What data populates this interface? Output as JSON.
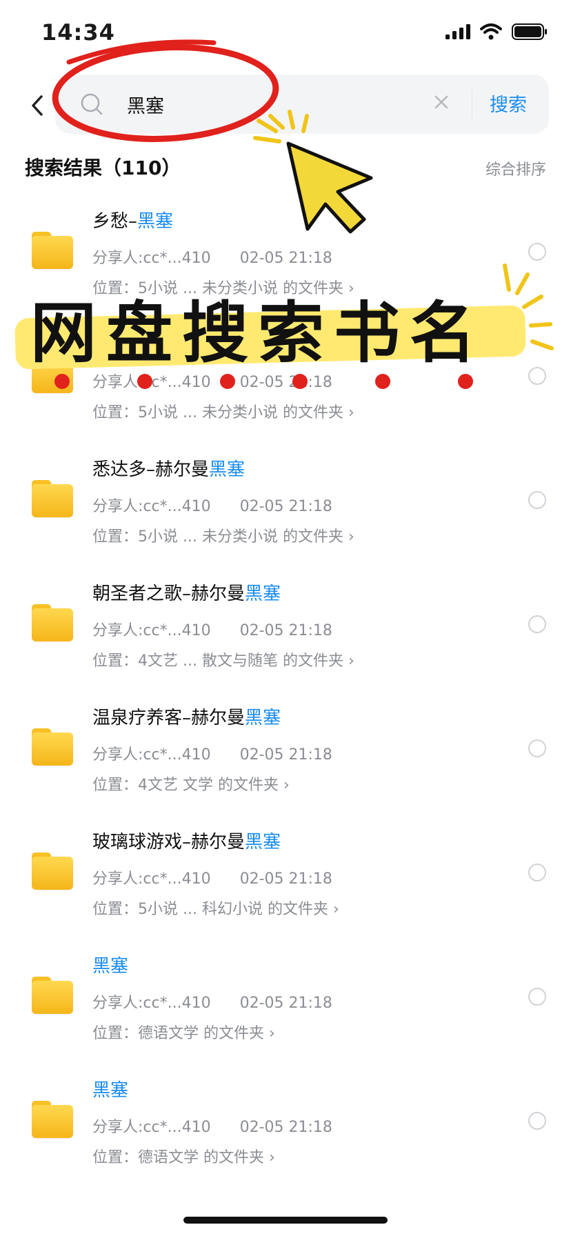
{
  "status_bar": {
    "time": "14:34"
  },
  "search": {
    "query": "黑塞",
    "button_label": "搜索"
  },
  "results": {
    "header": "搜索结果（110）",
    "sort_label": "综合排序"
  },
  "items": [
    {
      "title_prefix": "乡愁–",
      "title_highlight": "黑塞",
      "sharer": "分享人:cc*...410",
      "date": "02-05 21:18",
      "location": "位置：5小说   ... 未分类小说 的文件夹 ›"
    },
    {
      "title_prefix": "",
      "title_highlight": "",
      "sharer": "分享人:cc*...410",
      "date": "02-05 21:18",
      "location": "位置：5小说   ... 未分类小说 的文件夹 ›"
    },
    {
      "title_prefix": "悉达多–赫尔曼",
      "title_highlight": "黑塞",
      "sharer": "分享人:cc*...410",
      "date": "02-05 21:18",
      "location": "位置：5小说   ... 未分类小说 的文件夹 ›"
    },
    {
      "title_prefix": "朝圣者之歌–赫尔曼",
      "title_highlight": "黑塞",
      "sharer": "分享人:cc*...410",
      "date": "02-05 21:18",
      "location": "位置：4文艺   ... 散文与随笔 的文件夹 ›"
    },
    {
      "title_prefix": "温泉疗养客–赫尔曼",
      "title_highlight": "黑塞",
      "sharer": "分享人:cc*...410",
      "date": "02-05 21:18",
      "location": "位置：4文艺      文学 的文件夹 ›"
    },
    {
      "title_prefix": "玻璃球游戏–赫尔曼",
      "title_highlight": "黑塞",
      "sharer": "分享人:cc*...410",
      "date": "02-05 21:18",
      "location": "位置：5小说   ...  科幻小说 的文件夹 ›"
    },
    {
      "title_prefix": "",
      "title_highlight": "黑塞",
      "sharer": "分享人:cc*...410",
      "date": "02-05 21:18",
      "location": "位置：德语文学 的文件夹 ›"
    },
    {
      "title_prefix": "",
      "title_highlight": "黑塞",
      "sharer": "分享人:cc*...410",
      "date": "02-05 21:18",
      "location": "位置：德语文学 的文件夹 ›"
    }
  ],
  "overlay": {
    "banner_text": "网盘搜索书名"
  },
  "colors": {
    "accent": "#1a8cf0",
    "folder": "#f7c024",
    "highlight_band": "#ffe970",
    "annotation_red": "#e0211c"
  }
}
